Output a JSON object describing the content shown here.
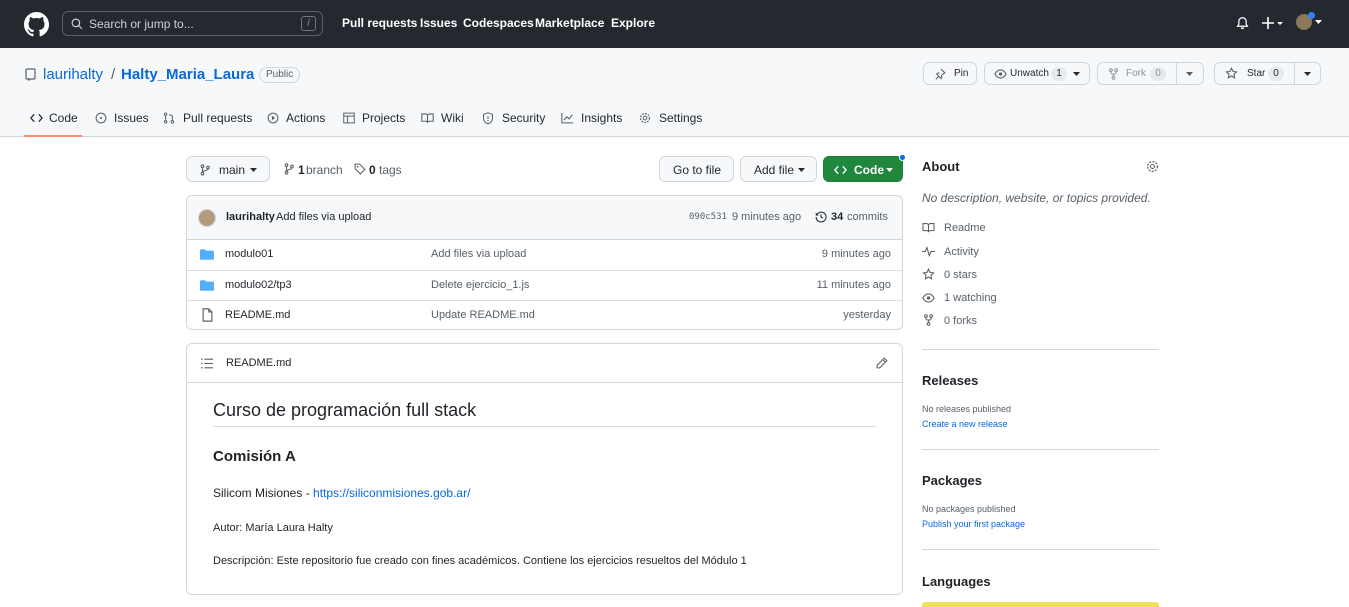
{
  "topbar": {
    "search_placeholder": "Search or jump to...",
    "search_shortcut": "/",
    "nav": [
      "Pull requests",
      "Issues",
      "Codespaces",
      "Marketplace",
      "Explore"
    ]
  },
  "repo": {
    "owner": "laurihalty",
    "separator": "/",
    "name": "Halty_Maria_Laura",
    "visibility": "Public",
    "actions": {
      "pin": "Pin",
      "unwatch": "Unwatch",
      "watch_count": "1",
      "fork": "Fork",
      "fork_count": "0",
      "star": "Star",
      "star_count": "0"
    },
    "tabs": [
      "Code",
      "Issues",
      "Pull requests",
      "Actions",
      "Projects",
      "Wiki",
      "Security",
      "Insights",
      "Settings"
    ]
  },
  "toolbar": {
    "branch": "main",
    "branch_count": "1",
    "branch_label": "branch",
    "tag_count": "0",
    "tag_label": "tags",
    "go_to_file": "Go to file",
    "add_file": "Add file",
    "code": "Code"
  },
  "commit": {
    "author": "laurihalty",
    "message": "Add files via upload",
    "sha": "090c531",
    "time": "9 minutes ago",
    "count": "34",
    "count_label": "commits"
  },
  "files": [
    {
      "name": "modulo01",
      "message": "Add files via upload",
      "time": "9 minutes ago",
      "type": "folder"
    },
    {
      "name": "modulo02/tp3",
      "message": "Delete ejercicio_1.js",
      "time": "11 minutes ago",
      "type": "folder"
    },
    {
      "name": "README.md",
      "message": "Update README.md",
      "time": "yesterday",
      "type": "file"
    }
  ],
  "readme": {
    "filename": "README.md",
    "h1": "Curso de programación full stack",
    "h2": "Comisión A",
    "line1_prefix": "Silicom Misiones - ",
    "line1_link": "https://siliconmisiones.gob.ar/",
    "author": "Autor: María Laura Halty",
    "description": "Descripción: Este repositorio fue creado con fines académicos. Contiene los ejercicios resueltos del Módulo 1"
  },
  "about": {
    "title": "About",
    "description": "No description, website, or topics provided.",
    "items": [
      "Readme",
      "Activity",
      "0 stars",
      "1 watching",
      "0 forks"
    ]
  },
  "releases": {
    "title": "Releases",
    "empty": "No releases published",
    "link": "Create a new release"
  },
  "packages": {
    "title": "Packages",
    "empty": "No packages published",
    "link": "Publish your first package"
  },
  "languages": {
    "title": "Languages",
    "bar_color": "#f1e05a"
  }
}
